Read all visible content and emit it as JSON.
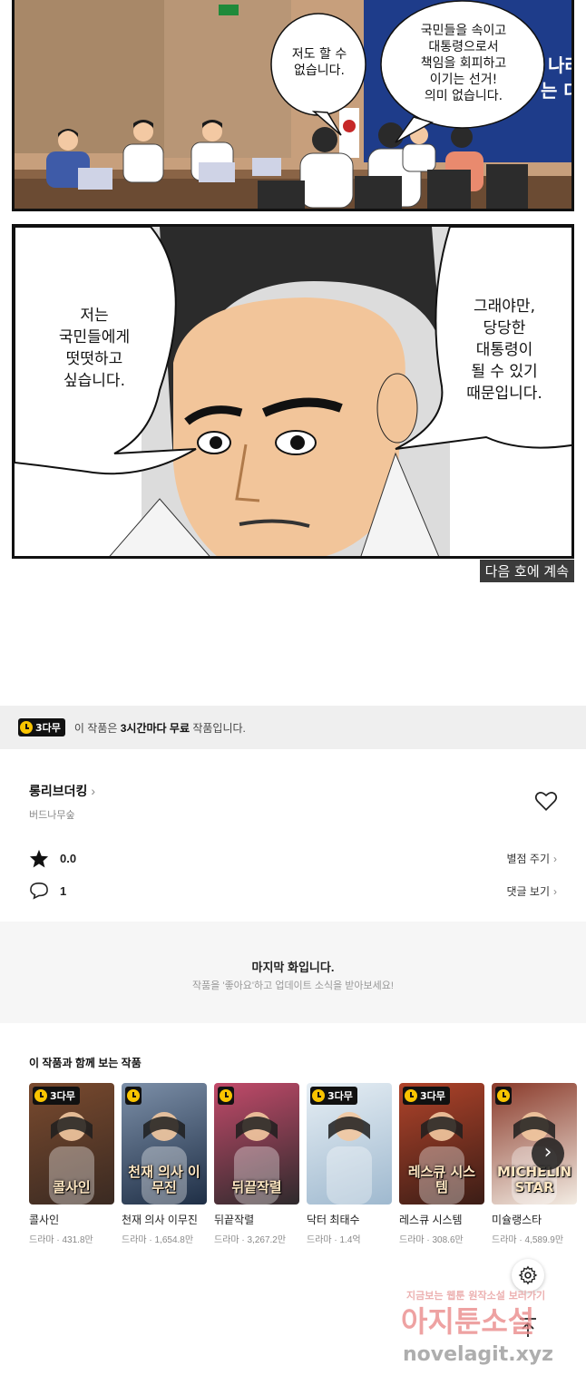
{
  "comic": {
    "panel1": {
      "bubble_left": "저도 할 수\n없습니다.",
      "bubble_right": "국민들을 속이고\n대통령으로서\n책임을 회피하고\n이기는 선거!\n의미 없습니다.",
      "sign_text_1": "나라",
      "sign_text_2": "는 대"
    },
    "panel2": {
      "bubble_left": "저는\n국민들에게\n떳떳하고\n싶습니다.",
      "bubble_right": "그래야만,\n당당한\n대통령이\n될 수 있기\n때문입니다."
    },
    "continue_label": "다음 호에 계속"
  },
  "free_bar": {
    "badge": "3다무",
    "text_prefix": "이 작품은 ",
    "text_bold": "3시간마다 무료",
    "text_suffix": " 작품입니다."
  },
  "series": {
    "title": "롱리브더킹",
    "author": "버드나무숲",
    "rating": "0.0",
    "rating_link": "별점 주기",
    "comments": "1",
    "comments_link": "댓글 보기"
  },
  "last_episode": {
    "title": "마지막 화입니다.",
    "subtitle": "작품을 '좋아요'하고 업데이트 소식을 받아보세요!"
  },
  "recommendations": {
    "title": "이 작품과 함께 보는 작품",
    "items": [
      {
        "name": "콜사인",
        "meta": "드라마 · 431.8만",
        "badge": "3다무",
        "cover_text": "콜사인",
        "colors": [
          "#3a2a22",
          "#7a4a2e"
        ]
      },
      {
        "name": "천재 의사 이무진",
        "meta": "드라마 · 1,654.8만",
        "badge": "",
        "cover_text": "천재 의사 이무진",
        "colors": [
          "#1f2f46",
          "#7c8fa8"
        ]
      },
      {
        "name": "뒤끝작렬",
        "meta": "드라마 · 3,267.2만",
        "badge": "",
        "cover_text": "뒤끝작렬",
        "colors": [
          "#2e2a2c",
          "#c24a6a"
        ]
      },
      {
        "name": "닥터 최태수",
        "meta": "드라마 · 1.4억",
        "badge": "3다무",
        "cover_text": "",
        "colors": [
          "#9fb9cf",
          "#e6eef4"
        ]
      },
      {
        "name": "레스큐 시스템",
        "meta": "드라마 · 308.6만",
        "badge": "3다무",
        "cover_text": "레스큐 시스템",
        "colors": [
          "#3b1d16",
          "#b0432a"
        ]
      },
      {
        "name": "미슐랭스타",
        "meta": "드라마 · 4,589.9만",
        "badge": "",
        "cover_text": "MICHELIN STAR",
        "colors": [
          "#f3ece3",
          "#8a3a2a"
        ]
      }
    ]
  },
  "watermark": {
    "line1": "지금보는 웹툰 원작소설 보러가기",
    "line2": "아지툰소설",
    "line3": "novelagit.xyz"
  },
  "colors": {
    "accent_yellow": "#f9c400",
    "bar_bg": "#efefef"
  },
  "icons": [
    "clock-icon",
    "chevron-right-icon",
    "heart-icon",
    "star-icon",
    "comment-icon",
    "gear-icon",
    "arrow-up-icon"
  ]
}
